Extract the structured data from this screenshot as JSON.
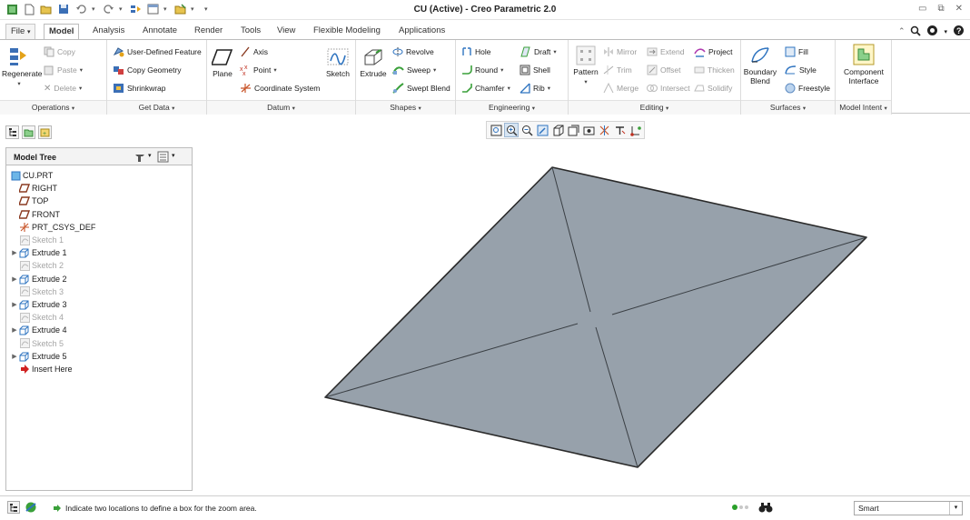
{
  "window": {
    "title": "CU (Active) - Creo Parametric 2.0"
  },
  "tabs": [
    "File",
    "Model",
    "Analysis",
    "Annotate",
    "Render",
    "Tools",
    "View",
    "Flexible Modeling",
    "Applications"
  ],
  "active_tab": "Model",
  "ribbon": {
    "operations": {
      "regenerate": "Regenerate",
      "copy": "Copy",
      "paste": "Paste",
      "delete": "Delete",
      "footer": "Operations"
    },
    "get_data": {
      "user_defined_feature": "User-Defined Feature",
      "copy_geometry": "Copy Geometry",
      "shrinkwrap": "Shrinkwrap",
      "footer": "Get Data"
    },
    "datum": {
      "plane": "Plane",
      "axis": "Axis",
      "point": "Point",
      "coordinate_system": "Coordinate System",
      "sketch": "Sketch",
      "footer": "Datum"
    },
    "shapes": {
      "extrude": "Extrude",
      "revolve": "Revolve",
      "sweep": "Sweep",
      "swept_blend": "Swept Blend",
      "footer": "Shapes"
    },
    "engineering": {
      "hole": "Hole",
      "round": "Round",
      "chamfer": "Chamfer",
      "draft": "Draft",
      "shell": "Shell",
      "rib": "Rib",
      "footer": "Engineering"
    },
    "editing": {
      "pattern": "Pattern",
      "mirror": "Mirror",
      "trim": "Trim",
      "merge": "Merge",
      "extend": "Extend",
      "offset": "Offset",
      "intersect": "Intersect",
      "project": "Project",
      "thicken": "Thicken",
      "solidify": "Solidify",
      "footer": "Editing"
    },
    "surfaces": {
      "boundary_blend_1": "Boundary",
      "boundary_blend_2": "Blend",
      "fill": "Fill",
      "style": "Style",
      "freestyle": "Freestyle",
      "footer": "Surfaces"
    },
    "model_intent": {
      "component_interface_1": "Component",
      "component_interface_2": "Interface",
      "footer": "Model Intent"
    }
  },
  "model_tree": {
    "header": "Model Tree",
    "items": [
      {
        "label": "CU.PRT",
        "icon": "part-icon",
        "expandable": false,
        "dim": false
      },
      {
        "label": "RIGHT",
        "icon": "datum-plane-icon",
        "expandable": false,
        "dim": false
      },
      {
        "label": "TOP",
        "icon": "datum-plane-icon",
        "expandable": false,
        "dim": false
      },
      {
        "label": "FRONT",
        "icon": "datum-plane-icon",
        "expandable": false,
        "dim": false
      },
      {
        "label": "PRT_CSYS_DEF",
        "icon": "csys-icon",
        "expandable": false,
        "dim": false
      },
      {
        "label": "Sketch 1",
        "icon": "sketch-icon",
        "expandable": false,
        "dim": true
      },
      {
        "label": "Extrude 1",
        "icon": "extrude-icon",
        "expandable": true,
        "dim": false
      },
      {
        "label": "Sketch 2",
        "icon": "sketch-icon",
        "expandable": false,
        "dim": true
      },
      {
        "label": "Extrude 2",
        "icon": "extrude-icon",
        "expandable": true,
        "dim": false
      },
      {
        "label": "Sketch 3",
        "icon": "sketch-icon",
        "expandable": false,
        "dim": true
      },
      {
        "label": "Extrude 3",
        "icon": "extrude-icon",
        "expandable": true,
        "dim": false
      },
      {
        "label": "Sketch 4",
        "icon": "sketch-icon",
        "expandable": false,
        "dim": true
      },
      {
        "label": "Extrude 4",
        "icon": "extrude-icon",
        "expandable": true,
        "dim": false
      },
      {
        "label": "Sketch 5",
        "icon": "sketch-icon",
        "expandable": false,
        "dim": true
      },
      {
        "label": "Extrude 5",
        "icon": "extrude-icon",
        "expandable": true,
        "dim": false
      },
      {
        "label": "Insert Here",
        "icon": "insert-arrow-icon",
        "expandable": false,
        "dim": false
      }
    ]
  },
  "status": {
    "message": "Indicate two locations to define a box for the zoom area.",
    "selection_filter": "Smart"
  },
  "colors": {
    "model_face": "#97a1ab",
    "model_edge": "#2a2a2a",
    "accent_blue": "#2f74c0",
    "tree_datum": "#8a3a20"
  }
}
